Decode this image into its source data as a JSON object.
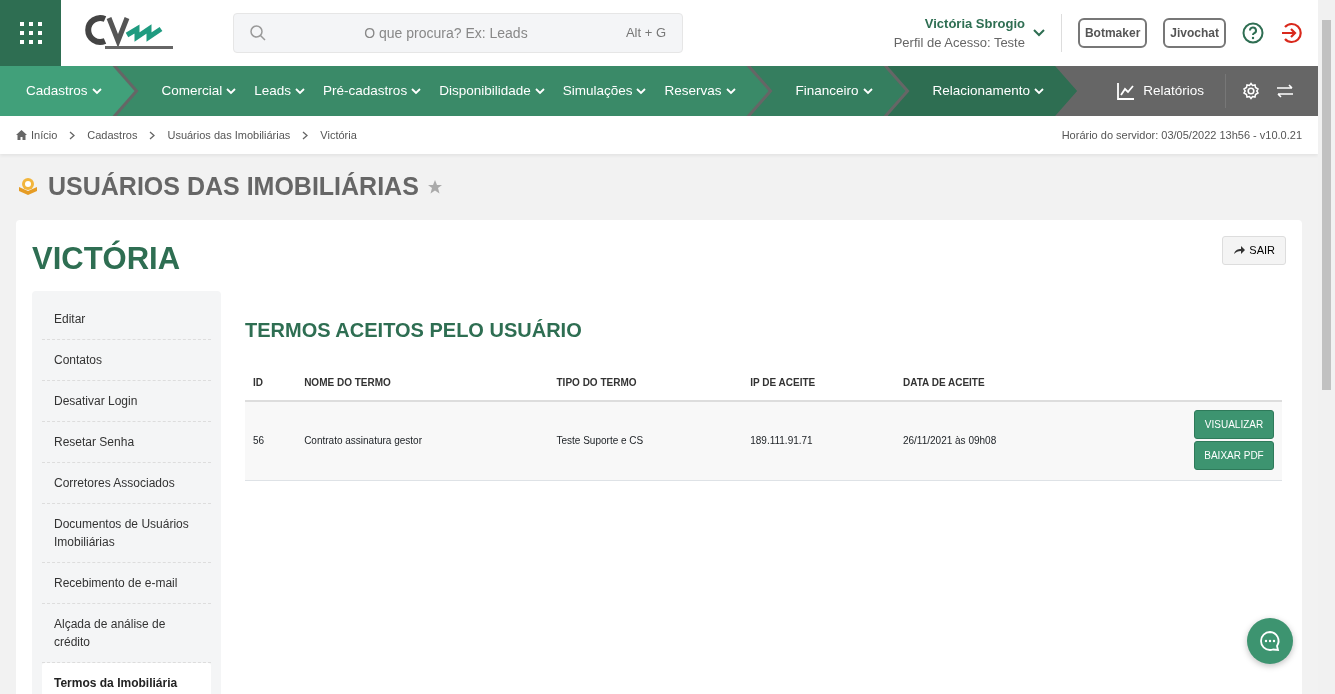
{
  "header": {
    "search": {
      "placeholder": "O que procura? Ex: Leads",
      "shortcut": "Alt + G"
    },
    "user": {
      "name": "Victória Sbrogio",
      "profile": "Perfil de Acesso: Teste"
    },
    "buttons": [
      "Botmaker",
      "Jivochat"
    ]
  },
  "main_menu": [
    {
      "color": "#41a07a",
      "items": [
        "Cadastros"
      ]
    },
    {
      "color": "#3a8a68",
      "items": [
        "Comercial",
        "Leads",
        "Pré-cadastros",
        "Disponibilidade",
        "Simulações",
        "Reservas"
      ]
    },
    {
      "color": "#357e5f",
      "items": [
        "Financeiro"
      ]
    },
    {
      "color": "#2e6e52",
      "items": [
        "Relacionamento"
      ]
    }
  ],
  "reports": "Relatórios",
  "breadcrumb": [
    "Início",
    "Cadastros",
    "Usuários das Imobiliárias",
    "Victória"
  ],
  "server_time": "Horário do servidor: 03/05/2022 13h56 - v10.0.21",
  "page_title": "USUÁRIOS DAS IMOBILIÁRIAS",
  "record_title": "VICTÓRIA",
  "exit_button": "SAIR",
  "sidebar": {
    "items": [
      {
        "label": "Editar",
        "selected": false
      },
      {
        "label": "Contatos",
        "selected": false
      },
      {
        "label": "Desativar Login",
        "selected": false
      },
      {
        "label": "Resetar Senha",
        "selected": false
      },
      {
        "label": "Corretores Associados",
        "selected": false
      },
      {
        "label": "Documentos de Usuários Imobiliárias",
        "selected": false
      },
      {
        "label": "Recebimento de e-mail",
        "selected": false
      },
      {
        "label": "Alçada de análise de crédito",
        "selected": false
      },
      {
        "label": "Termos da Imobiliária",
        "selected": true
      }
    ]
  },
  "section_title": "TERMOS ACEITOS PELO USUÁRIO",
  "table": {
    "columns": [
      "ID",
      "NOME DO TERMO",
      "TIPO DO TERMO",
      "IP DE ACEITE",
      "DATA DE ACEITE"
    ],
    "rows": [
      {
        "cells": [
          "56",
          "Contrato assinatura gestor",
          "Teste Suporte e CS",
          "189.111.91.71",
          "26/11/2021 às 09h08"
        ],
        "actions": [
          "VISUALIZAR",
          "BAIXAR PDF"
        ]
      }
    ]
  }
}
